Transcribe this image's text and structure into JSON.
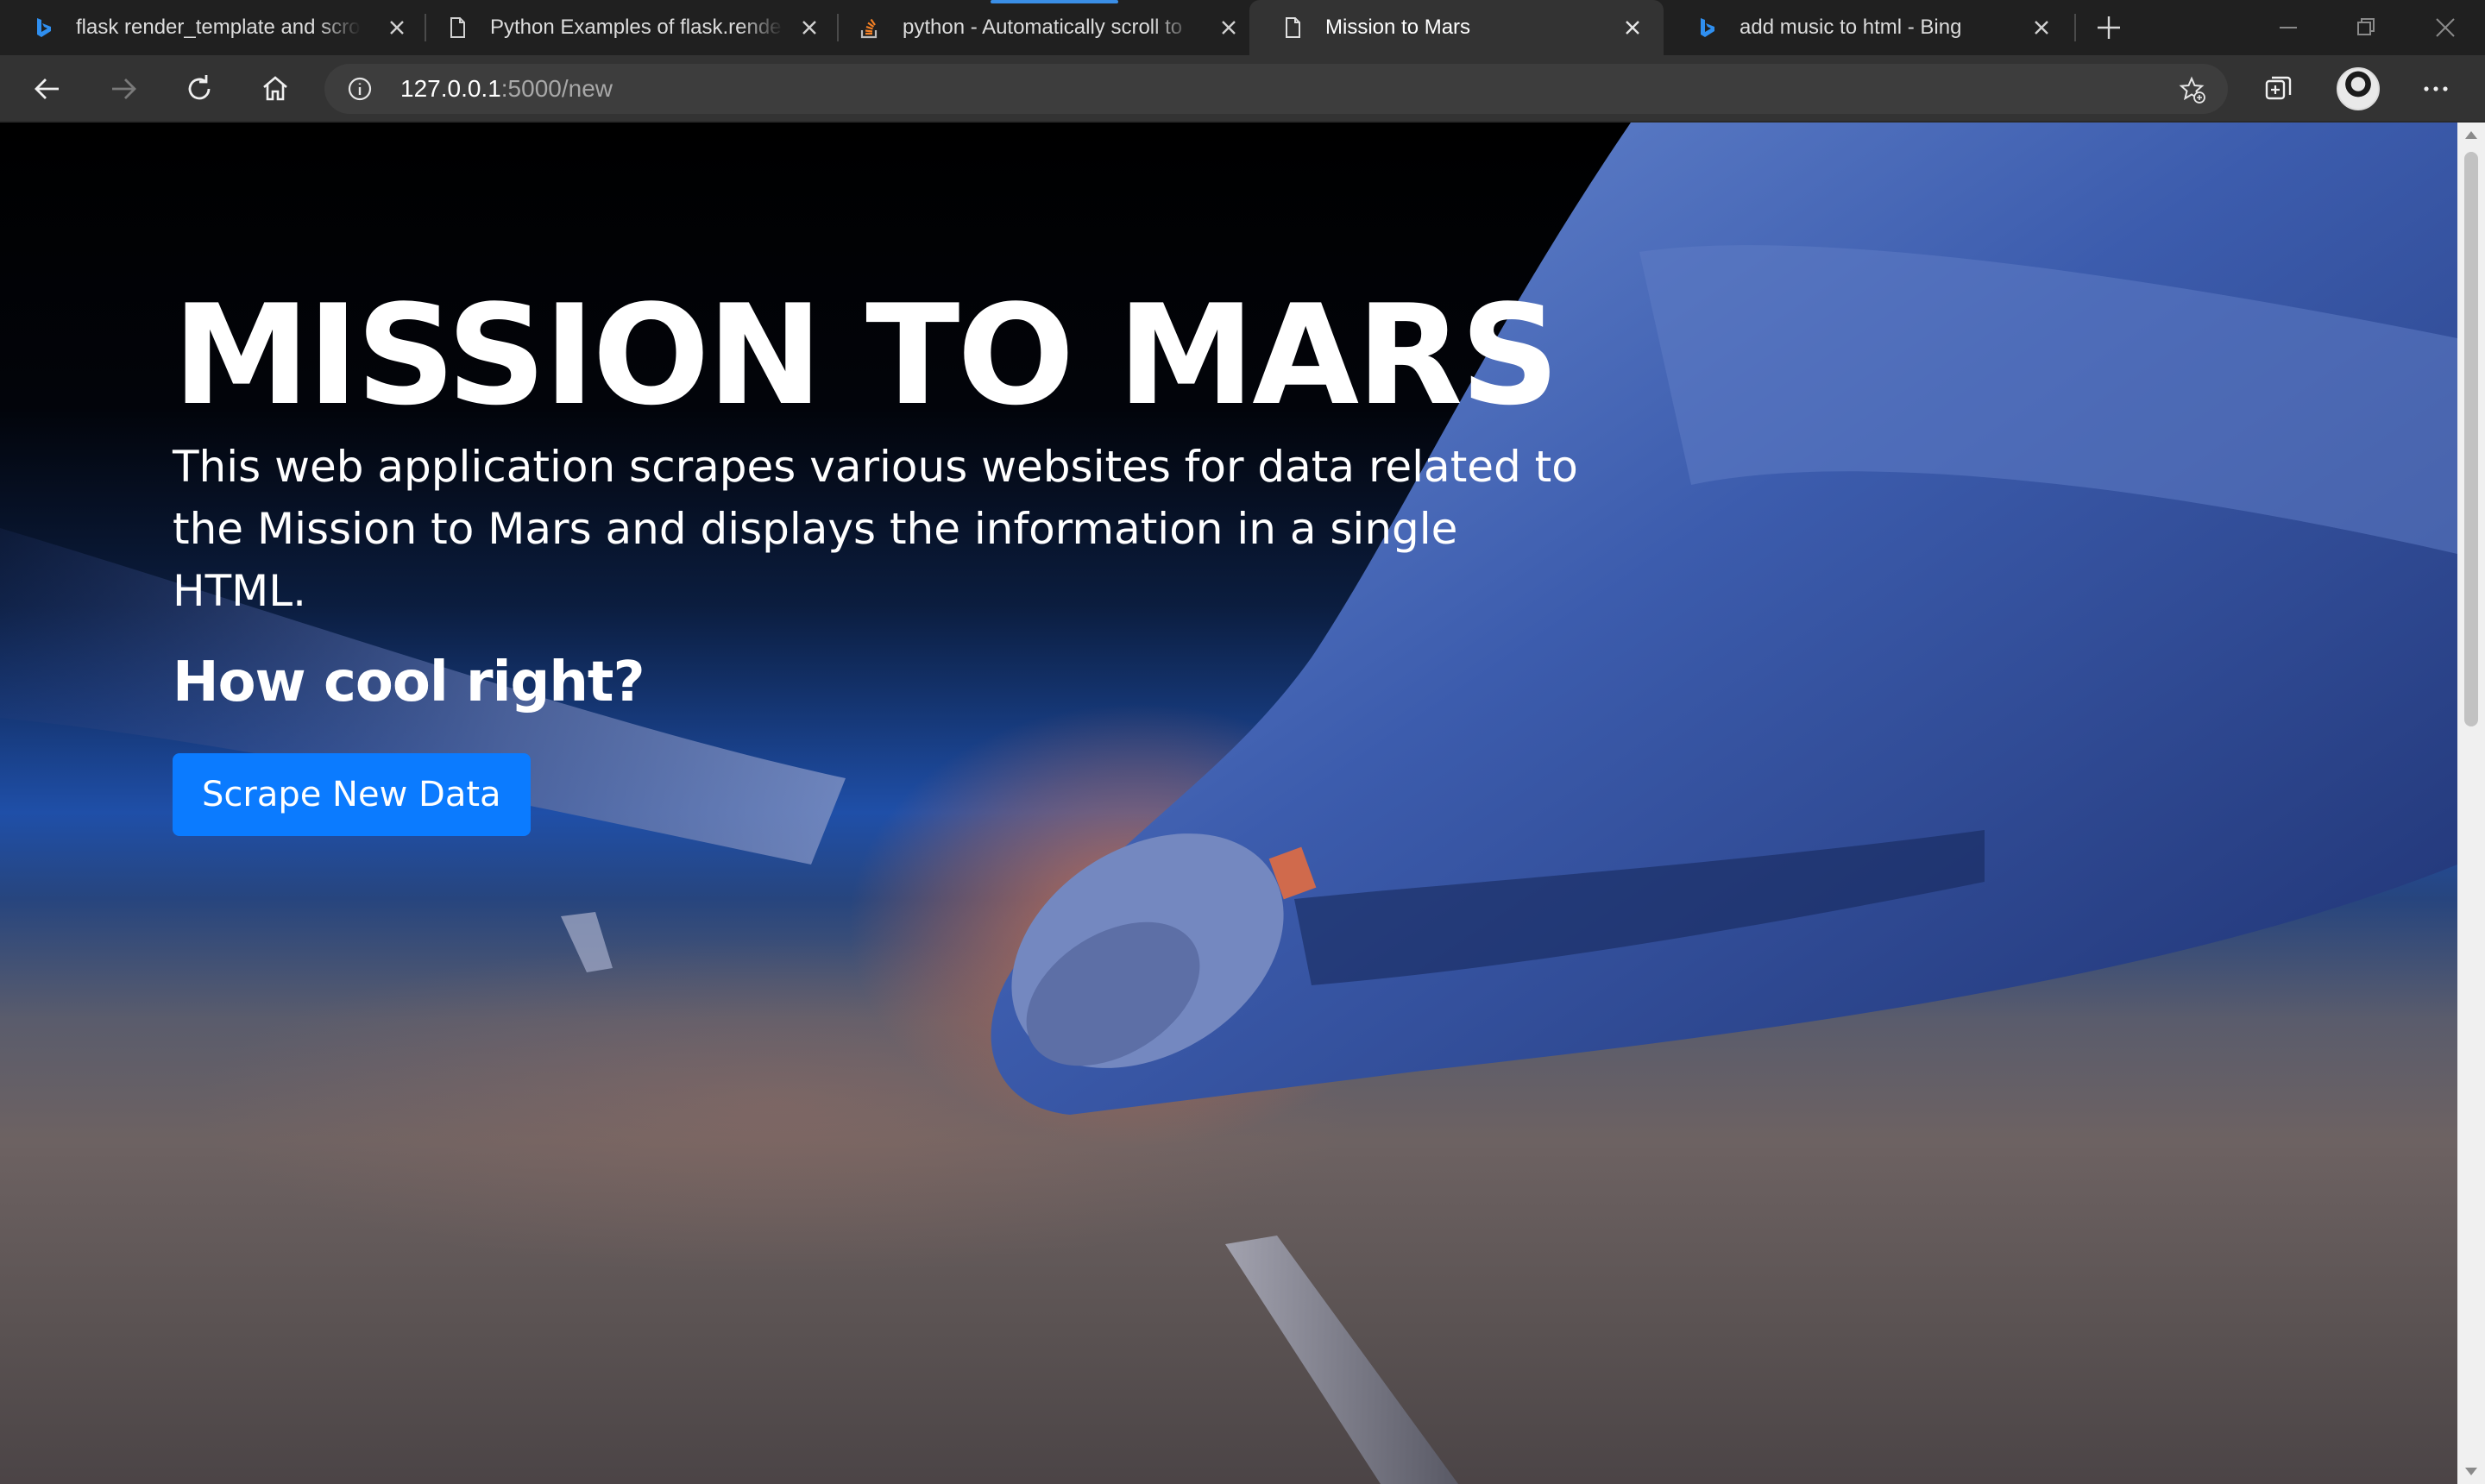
{
  "browser": {
    "tabs": [
      {
        "title": "flask render_template and scroll",
        "icon": "bing-icon",
        "active": false
      },
      {
        "title": "Python Examples of flask.render_",
        "icon": "page-icon",
        "active": false
      },
      {
        "title": "python - Automatically scroll to",
        "icon": "stackoverflow-icon",
        "active": false
      },
      {
        "title": "Mission to Mars",
        "icon": "page-icon",
        "active": true
      },
      {
        "title": "add music to html - Bing",
        "icon": "bing-icon",
        "active": false
      }
    ],
    "address": {
      "host": "127.0.0.1",
      "path": ":5000/new"
    },
    "accent_color": "#3a8ee6"
  },
  "page": {
    "title": "MISSION TO MARS",
    "description": "This web application scrapes various websites for data related to the Mission to Mars and displays the information in a single HTML.",
    "subheading": "How cool right?",
    "button_label": "Scrape New Data",
    "button_color": "#0b7bff"
  }
}
